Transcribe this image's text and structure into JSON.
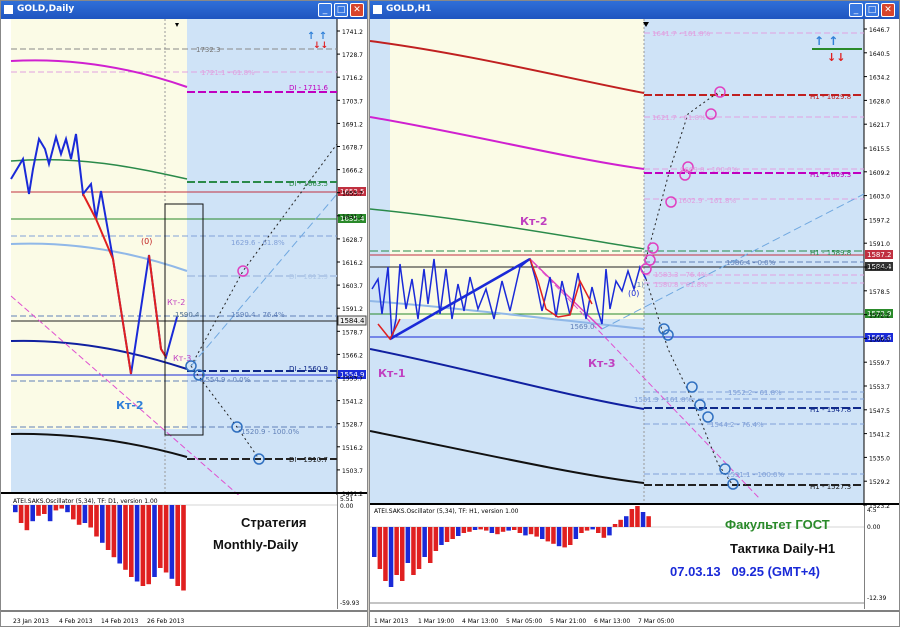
{
  "left": {
    "title": "GOLD,Daily",
    "price_ticks": [
      "1741.2",
      "1728.7",
      "1716.2",
      "1703.7",
      "1691.2",
      "1678.7",
      "1666.2",
      "1653.7",
      "1641.2",
      "1628.7",
      "1616.2",
      "1603.7",
      "1591.2",
      "1578.7",
      "1566.2",
      "1553.7",
      "1541.2",
      "1528.7",
      "1516.2",
      "1503.7",
      "1491.2"
    ],
    "price_tags": {
      "red": "1653.5",
      "green": "1635.4",
      "white": "1584.4",
      "blue": "1554.9"
    },
    "levels": [
      {
        "text": "1732.3",
        "color": "#777"
      },
      {
        "text": "1721.1 - 61.8%",
        "color": "#e0a0e0"
      },
      {
        "text": "DI - 1711.6",
        "color": "#c000c0"
      },
      {
        "text": "DI - 1663.5",
        "color": "#2a8a4a"
      },
      {
        "text": "1629.6 - 61.8%",
        "color": "#80a0d8"
      },
      {
        "text": "DI - 1611.9",
        "color": "#b0c8e8"
      },
      {
        "text": "1590.4",
        "color": "#507090"
      },
      {
        "text": "1590.4 - 76.4%",
        "color": "#6080b8"
      },
      {
        "text": "DI - 1560.9",
        "color": "#102a8a"
      },
      {
        "text": "1554.9 - 0.0%",
        "color": "#6080b8"
      },
      {
        "text": "1520.9 - 100.0%",
        "color": "#6080b8"
      },
      {
        "text": "DI - 1510.7",
        "color": "#222"
      }
    ],
    "wave_labels": {
      "zero": "(0)",
      "kt2_small": "Кт-2",
      "kt3_small": "Кт-3",
      "kt2_big": "Кт-2"
    },
    "osc_title": "ATEI.SAKS.Oscillator (5,34), TF: D1, version 1.00",
    "osc_ticks": [
      "5.51",
      "0.00",
      "-59.93"
    ],
    "strategy_line1": "Стратегия",
    "strategy_line2": "Monthly-Daily",
    "date_ticks": [
      "23 Jan 2013",
      "4 Feb 2013",
      "14 Feb 2013",
      "26 Feb 2013"
    ]
  },
  "right": {
    "title": "GOLD,H1",
    "price_ticks": [
      "1646.7",
      "1640.5",
      "1634.2",
      "1628.0",
      "1621.7",
      "1615.5",
      "1609.2",
      "1603.0",
      "1597.2",
      "1591.0",
      "1584.7",
      "1578.5",
      "1572.2",
      "1566.0",
      "1559.7",
      "1553.7",
      "1547.5",
      "1541.2",
      "1535.0",
      "1529.2",
      "1523.2"
    ],
    "price_tags": {
      "red": "1587.2",
      "dark": "1584.4",
      "green": "1573.9",
      "blue": "1565.6"
    },
    "levels": [
      {
        "text": "1641.7 - 161.8%",
        "color": "#e0a0e0"
      },
      {
        "text": "H1 - 1629.8",
        "color": "#c02020"
      },
      {
        "text": "1621.7 - 61.8%",
        "color": "#e0a0e0"
      },
      {
        "text": "1609.8 - 100.0%",
        "color": "#e0a0e0"
      },
      {
        "text": "H1 - 1609.3",
        "color": "#c000c0"
      },
      {
        "text": "1602.9 - 161.8%",
        "color": "#e0a0e0"
      },
      {
        "text": "H1 - 1589.8",
        "color": "#2a8a4a"
      },
      {
        "text": "1586.4 - 0.0%",
        "color": "#6080b8"
      },
      {
        "text": "1583.3 - 76.4%",
        "color": "#e0a0e0"
      },
      {
        "text": "1580.8 - 61.8%",
        "color": "#e0a0e0"
      },
      {
        "text": "1569.0",
        "color": "#6080b8"
      },
      {
        "text": "1552.2 - 61.8%",
        "color": "#80a0d8"
      },
      {
        "text": "1551.3 - 161.8%",
        "color": "#80a0d8"
      },
      {
        "text": "H1 - 1547.8",
        "color": "#102a8a"
      },
      {
        "text": "1544.2 - 76.4%",
        "color": "#80a0d8"
      },
      {
        "text": "1531.1 - 100.0%",
        "color": "#80a0d8"
      },
      {
        "text": "H1 - 1527.3",
        "color": "#222"
      }
    ],
    "wave_labels": {
      "kt1": "Кт-1",
      "kt2": "Кт-2",
      "kt3": "Кт-3",
      "zero": "(0)",
      "b": "(1)"
    },
    "osc_title": "ATEI.SAKS.Oscillator (5,34), TF: H1, version 1.00",
    "osc_ticks": [
      "4.5",
      "0.00",
      "-12.39"
    ],
    "faculty": "Факультет ГОСТ",
    "tactic": "Тактика Daily-H1",
    "datetime": "07.03.13   09.25 (GMT+4)",
    "date_ticks": [
      "1 Mar 2013",
      "1 Mar 19:00",
      "4 Mar 13:00",
      "5 Mar 05:00",
      "5 Mar 21:00",
      "6 Mar 13:00",
      "7 Mar 05:00"
    ]
  },
  "colors": {
    "title_bar": "#2f6fd8",
    "chart_bg": "#cfe3f7",
    "future_bg": "#fbfbe6",
    "bull_bar": "#1a2ad8",
    "bear_bar": "#e02020"
  }
}
